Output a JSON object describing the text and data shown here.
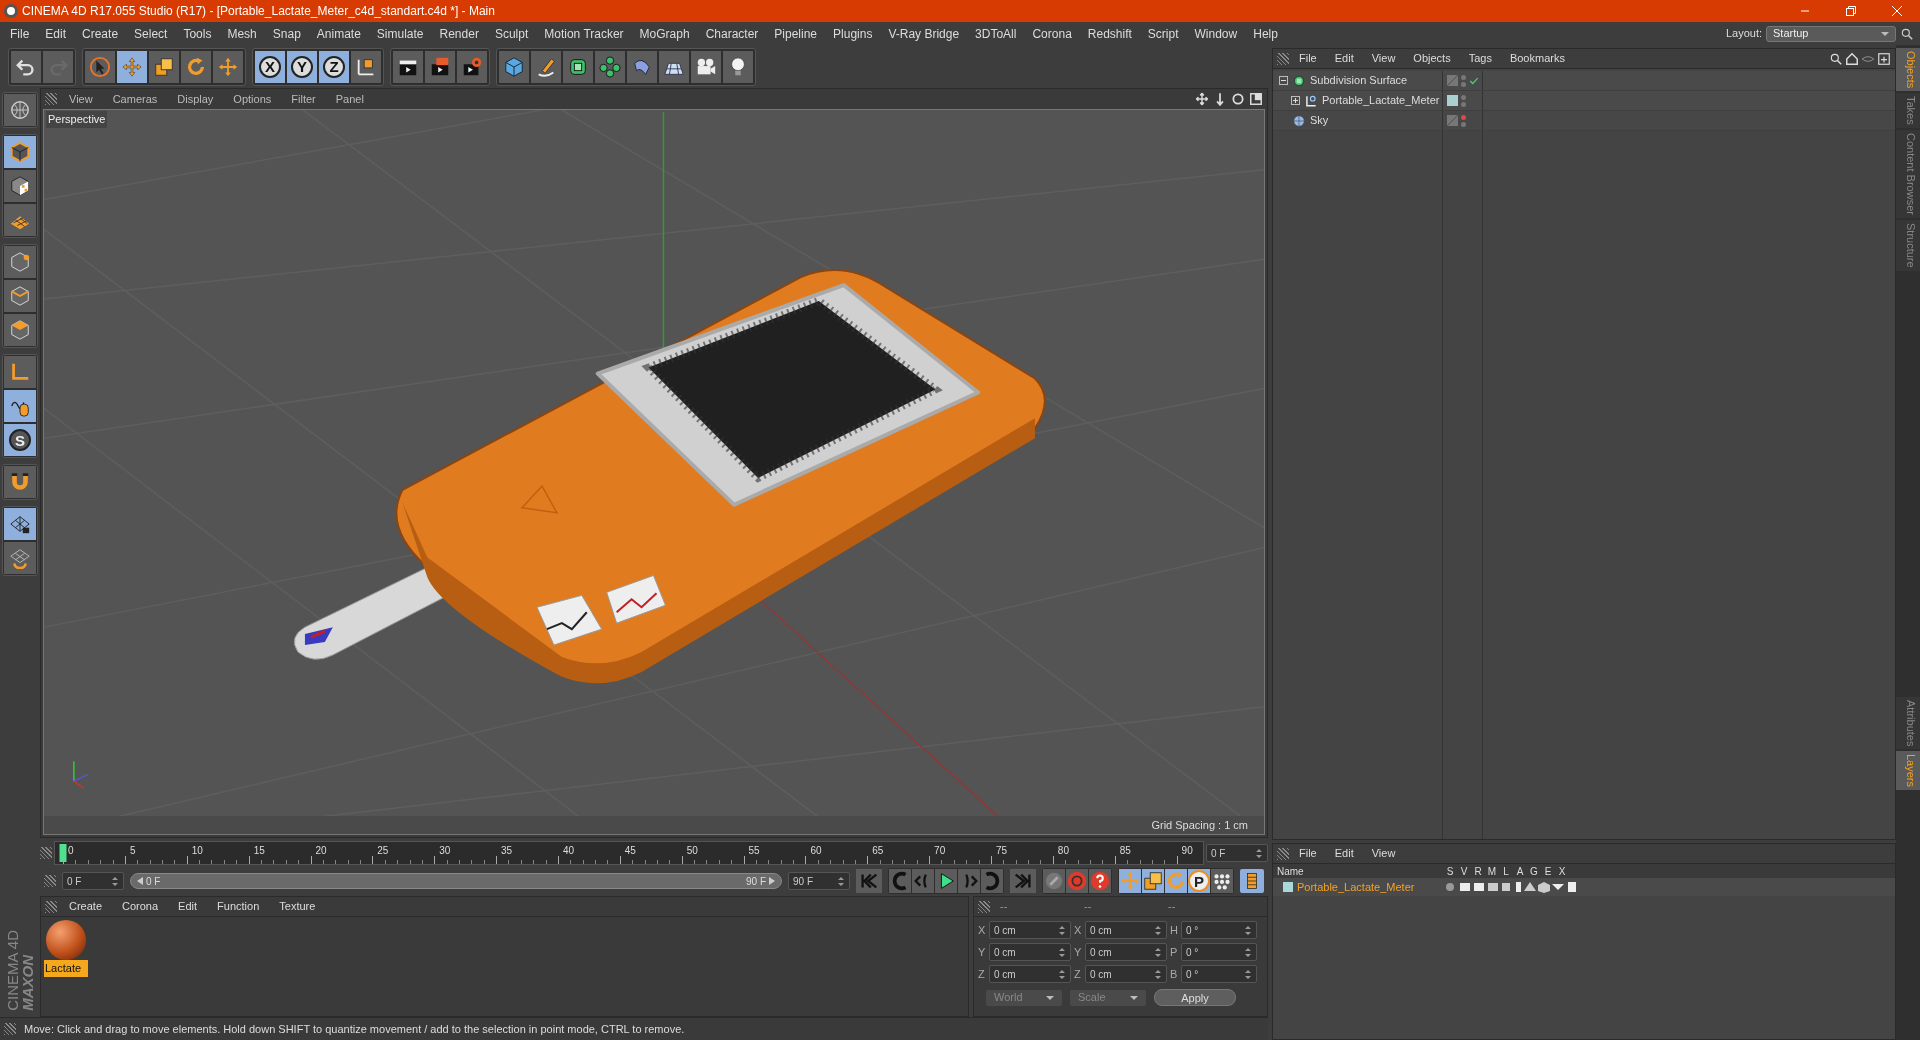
{
  "window": {
    "title": "CINEMA 4D R17.055 Studio (R17) - [Portable_Lactate_Meter_c4d_standart.c4d *] - Main"
  },
  "menu": [
    "File",
    "Edit",
    "Create",
    "Select",
    "Tools",
    "Mesh",
    "Snap",
    "Animate",
    "Simulate",
    "Render",
    "Sculpt",
    "Motion Tracker",
    "MoGraph",
    "Character",
    "Pipeline",
    "Plugins",
    "V-Ray Bridge",
    "3DToAll",
    "Corona",
    "Redshift",
    "Script",
    "Window",
    "Help"
  ],
  "layout": {
    "label": "Layout:",
    "value": "Startup"
  },
  "toolbar": [
    [
      {
        "kind": "undo",
        "selected": false
      },
      {
        "kind": "redo",
        "selected": false
      }
    ],
    [
      {
        "kind": "select",
        "selected": false
      },
      {
        "kind": "move",
        "selected": true
      },
      {
        "kind": "scale",
        "selected": false
      },
      {
        "kind": "rotate",
        "selected": false
      },
      {
        "kind": "transform",
        "selected": false
      }
    ],
    [
      {
        "kind": "axis",
        "label": "X",
        "selected": true
      },
      {
        "kind": "axis",
        "label": "Y",
        "selected": true
      },
      {
        "kind": "axis",
        "label": "Z",
        "selected": true
      },
      {
        "kind": "coords",
        "selected": false
      }
    ],
    [
      {
        "kind": "render_view",
        "selected": false
      },
      {
        "kind": "render",
        "selected": false
      },
      {
        "kind": "render_settings",
        "selected": false
      }
    ],
    [
      {
        "kind": "cube",
        "selected": false
      },
      {
        "kind": "pen",
        "selected": false
      },
      {
        "kind": "subdivision",
        "selected": false
      },
      {
        "kind": "cloner",
        "selected": false
      },
      {
        "kind": "deformer",
        "selected": false
      },
      {
        "kind": "floor",
        "selected": false
      },
      {
        "kind": "camera",
        "selected": false
      },
      {
        "kind": "light",
        "selected": false
      }
    ]
  ],
  "left_tools": [
    [
      {
        "kind": "world",
        "selected": false
      }
    ],
    [
      {
        "kind": "model",
        "selected": true
      },
      {
        "kind": "texture",
        "selected": false
      },
      {
        "kind": "workplane",
        "selected": false
      }
    ],
    [
      {
        "kind": "points",
        "selected": false
      },
      {
        "kind": "edges",
        "selected": false
      },
      {
        "kind": "polygons",
        "selected": false
      }
    ],
    [
      {
        "kind": "axis_tool",
        "selected": false
      },
      {
        "kind": "tweak",
        "selected": true
      },
      {
        "kind": "snap",
        "label": "S",
        "selected": true
      }
    ],
    [
      {
        "kind": "magnet",
        "selected": false
      }
    ],
    [
      {
        "kind": "grid_lock",
        "selected": true
      },
      {
        "kind": "grid_rotate",
        "selected": false
      }
    ]
  ],
  "brand": {
    "maker": "MAXON",
    "product": "CINEMA 4D"
  },
  "viewport": {
    "menu": [
      "View",
      "Cameras",
      "Display",
      "Options",
      "Filter",
      "Panel"
    ],
    "camera": "Perspective",
    "grid_spacing": "Grid Spacing : 1 cm"
  },
  "timeline": {
    "ticks": [
      "0",
      "5",
      "10",
      "15",
      "20",
      "25",
      "30",
      "35",
      "40",
      "45",
      "50",
      "55",
      "60",
      "65",
      "70",
      "75",
      "80",
      "85",
      "90"
    ],
    "current_frame": "0 F",
    "start_field": "0 F",
    "range_start": "0 F",
    "range_end": "90 F",
    "level": 1,
    "end_field": "90 F",
    "transport": [
      {
        "kind": "first",
        "selected": false
      },
      {
        "kind": "prev_key",
        "selected": false
      },
      {
        "kind": "prev_frame",
        "selected": false
      },
      {
        "kind": "play",
        "selected": false
      },
      {
        "kind": "next_frame",
        "selected": false
      },
      {
        "kind": "next_key",
        "selected": false
      },
      {
        "kind": "last",
        "selected": false
      }
    ],
    "keys": [
      {
        "kind": "key_off",
        "selected": false
      },
      {
        "kind": "record",
        "selected": false
      },
      {
        "kind": "autokey",
        "selected": false
      }
    ],
    "key_filters": [
      {
        "kind": "tmove",
        "selected": true
      },
      {
        "kind": "tscale",
        "selected": true
      },
      {
        "kind": "trotate",
        "selected": true
      },
      {
        "kind": "param",
        "label": "P",
        "selected": true
      },
      {
        "kind": "dots",
        "selected": false
      }
    ]
  },
  "materials": {
    "menu": [
      "Create",
      "Corona",
      "Edit",
      "Function",
      "Texture"
    ],
    "items": [
      {
        "name": "Lactate",
        "selected": true
      }
    ]
  },
  "coordinates": {
    "headers": [
      "--",
      "--",
      "--"
    ],
    "rows": [
      {
        "axis": "X",
        "position": "0 cm",
        "size_axis": "X",
        "size": "0 cm",
        "rot_axis": "H",
        "rotation": "0 °"
      },
      {
        "axis": "Y",
        "position": "0 cm",
        "size_axis": "Y",
        "size": "0 cm",
        "rot_axis": "P",
        "rotation": "0 °"
      },
      {
        "axis": "Z",
        "position": "0 cm",
        "size_axis": "Z",
        "size": "0 cm",
        "rot_axis": "B",
        "rotation": "0 °"
      }
    ],
    "space": "World",
    "mode": "Scale",
    "apply": "Apply"
  },
  "status_bar": "Move: Click and drag to move elements. Hold down SHIFT to quantize movement / add to the selection in point mode, CTRL to remove.",
  "objects": {
    "menu": [
      "File",
      "Edit",
      "View",
      "Objects",
      "Tags",
      "Bookmarks"
    ],
    "tree": [
      {
        "name": "Subdivision Surface",
        "kind": "subdivision",
        "expanded": true,
        "enabled": true,
        "hidden_in_render": false,
        "children": [
          {
            "name": "Portable_Lactate_Meter",
            "kind": "null",
            "expanded": false,
            "enabled": false,
            "hidden_in_render": false,
            "color": "#a8d0d0"
          }
        ]
      },
      {
        "name": "Sky",
        "kind": "sky",
        "enabled": false,
        "hidden_in_render": true
      }
    ]
  },
  "layers": {
    "menu": [
      "File",
      "Edit",
      "View"
    ],
    "columns": [
      "Name",
      "S",
      "V",
      "R",
      "M",
      "L",
      "A",
      "G",
      "E",
      "X"
    ],
    "items": [
      {
        "name": "Portable_Lactate_Meter",
        "color": "#a8d8d8"
      }
    ]
  },
  "side_tabs": [
    {
      "label": "Objects",
      "selected": true
    },
    {
      "label": "Takes",
      "selected": false
    },
    {
      "label": "Content Browser",
      "selected": false
    },
    {
      "label": "Structure",
      "selected": false
    }
  ],
  "side_tabs_bottom": [
    {
      "label": "Attributes",
      "selected": false
    },
    {
      "label": "Layers",
      "selected": true
    }
  ]
}
